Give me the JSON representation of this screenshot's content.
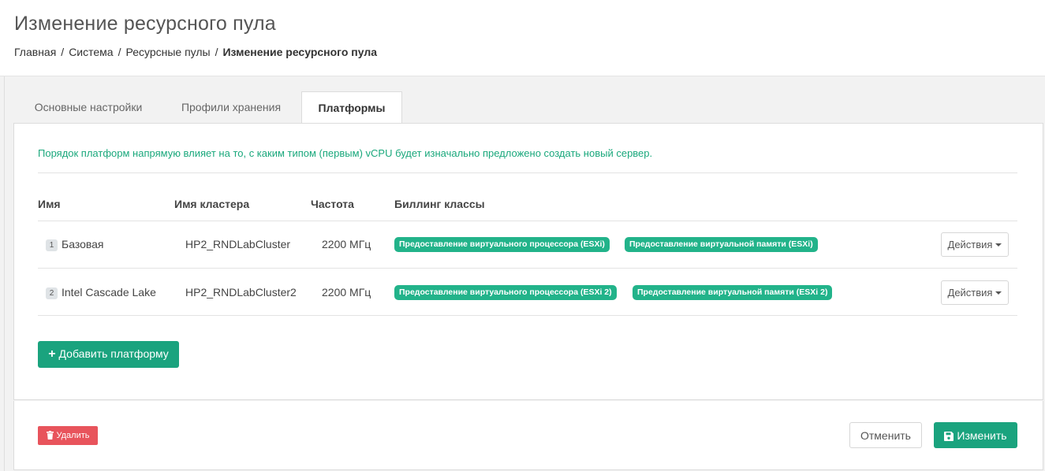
{
  "header": {
    "title": "Изменение ресурсного пула",
    "breadcrumb": [
      "Главная",
      "Система",
      "Ресурсные пулы"
    ],
    "breadcrumb_separator": "/",
    "breadcrumb_current": "Изменение ресурсного пула"
  },
  "tabs": [
    {
      "label": "Основные настройки",
      "active": false
    },
    {
      "label": "Профили хранения",
      "active": false
    },
    {
      "label": "Платформы",
      "active": true
    }
  ],
  "platforms": {
    "info": "Порядок платформ напрямую влияет на то, с каким типом (первым) vCPU будет изначально предложено создать новый сервер.",
    "columns": [
      "Имя",
      "Имя кластера",
      "Частота",
      "Биллинг классы"
    ],
    "rows": [
      {
        "index": "1",
        "name": "Базовая",
        "cluster": "HP2_RNDLabCluster",
        "frequency": "2200 МГц",
        "billing": [
          "Предоставление виртуального процессора (ESXi)",
          "Предоставление виртуальной памяти (ESXi)"
        ],
        "actions_label": "Действия"
      },
      {
        "index": "2",
        "name": "Intel Cascade Lake",
        "cluster": "HP2_RNDLabCluster2",
        "frequency": "2200 МГц",
        "billing": [
          "Предоставление виртуального процессора (ESXi 2)",
          "Предоставление виртуальной памяти (ESXi 2)"
        ],
        "actions_label": "Действия"
      }
    ],
    "add_button": "Добавить платформу"
  },
  "footer": {
    "delete_label": "Удалить",
    "cancel_label": "Отменить",
    "save_label": "Изменить"
  },
  "colors": {
    "accent": "#1aa37e",
    "danger": "#e8545c",
    "info_text": "#1aa87c"
  },
  "icons": {
    "add": "plus-icon",
    "delete": "trash-icon",
    "save": "floppy-disk-icon",
    "actions": "caret-down-icon"
  }
}
